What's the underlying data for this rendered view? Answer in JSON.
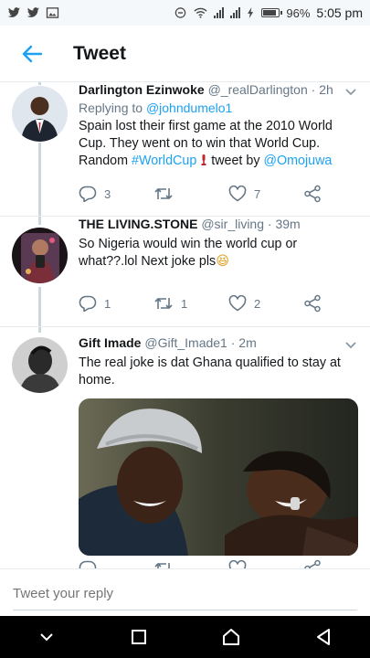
{
  "status_bar": {
    "battery": "96%",
    "time": "5:05 pm"
  },
  "header": {
    "title": "Tweet"
  },
  "tweets": [
    {
      "name": "Darlington Ezinwoke",
      "handle": "@_realDarlington",
      "sep": " · ",
      "time": "2h",
      "replying_prefix": "Replying to ",
      "replying_to": "@johndumelo1",
      "text": "Spain lost their first game at the 2010 World Cup. They went on to win that World Cup. Random ",
      "hashtag": "#WorldCup",
      "text_suffix": " tweet by ",
      "mention": "@Omojuwa",
      "replies": "3",
      "retweets": "",
      "likes": "7"
    },
    {
      "name": "THE LIVING.STONE",
      "handle": "@sir_living",
      "sep": " · ",
      "time": "39m",
      "text": "So Nigeria would win the world cup or what??.lol Next joke pls",
      "emoji": "😆",
      "replies": "1",
      "retweets": "1",
      "likes": "2"
    },
    {
      "name": "Gift Imade",
      "handle": "@Gift_Imade1",
      "sep": " · ",
      "time": "2m",
      "text": "The real joke is dat Ghana qualified to stay at home."
    }
  ],
  "reply": {
    "placeholder": "Tweet your reply"
  },
  "icons": {
    "back": "back-arrow-icon",
    "reply": "reply-icon",
    "retweet": "retweet-icon",
    "like": "heart-icon",
    "share": "share-icon"
  },
  "colors": {
    "accent": "#1da1f2",
    "muted": "#657786",
    "text": "#14171a",
    "thread_line": "#ccd6dd"
  }
}
